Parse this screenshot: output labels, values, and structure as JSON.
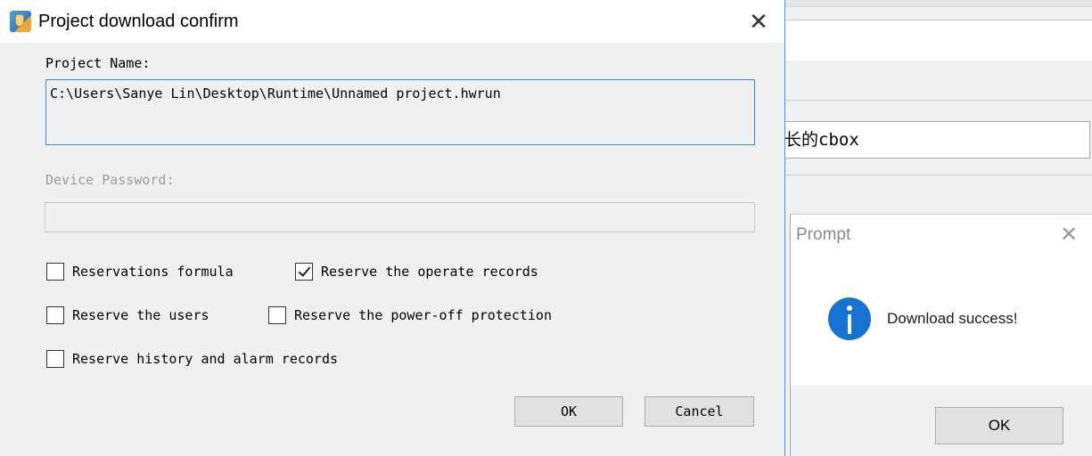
{
  "background_app": {
    "field_text": "长的cbox"
  },
  "prompt": {
    "title": "Prompt",
    "close_glyph": "✕",
    "icon": "info-icon",
    "message": "Download success!",
    "ok_label": "OK"
  },
  "dialog": {
    "title": "Project download confirm",
    "app_icon": "app-icon",
    "close_glyph": "✕",
    "project_name_label": "Project Name:",
    "project_name_value": "C:\\Users\\Sanye Lin\\Desktop\\Runtime\\Unnamed project.hwrun",
    "password_label": "Device Password:",
    "password_value": "",
    "options": {
      "reservations_formula": {
        "label": "Reservations formula",
        "checked": false
      },
      "reserve_operate_records": {
        "label": "Reserve the operate records",
        "checked": true
      },
      "reserve_users": {
        "label": "Reserve the users",
        "checked": false
      },
      "reserve_power_off": {
        "label": "Reserve the power-off protection",
        "checked": false
      },
      "reserve_history_alarm": {
        "label": "Reserve history and alarm records",
        "checked": false
      }
    },
    "ok_label": "OK",
    "cancel_label": "Cancel"
  },
  "colors": {
    "focus_border": "#3a8ad9",
    "info_icon": "#1673d1",
    "disabled_text": "#9c9c9c"
  }
}
